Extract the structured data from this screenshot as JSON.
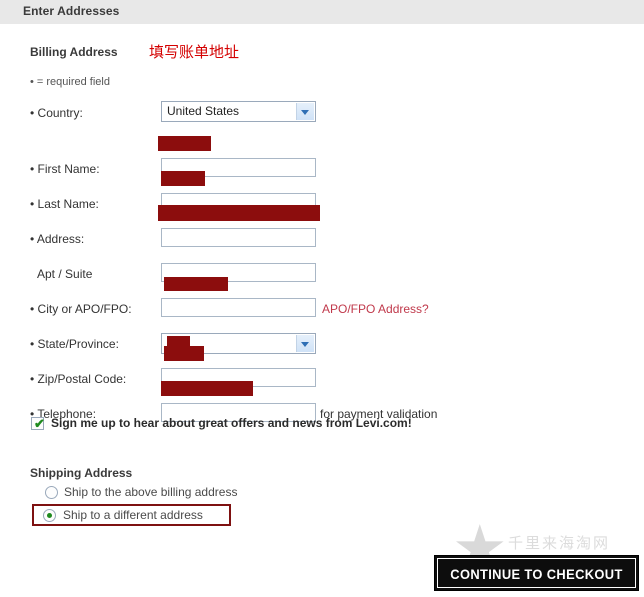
{
  "header": {
    "title": "Enter Addresses"
  },
  "billing": {
    "section_title": "Billing Address",
    "annotation_cn": "填写账单地址",
    "required_note": "• = required field",
    "fields": [
      {
        "label": "• Country:",
        "type": "select",
        "value": "United States",
        "name": "country"
      },
      {
        "label": "• First Name:",
        "type": "text",
        "value": "",
        "redacted": true,
        "name": "first-name"
      },
      {
        "label": "• Last Name:",
        "type": "text",
        "value": "",
        "redacted": true,
        "name": "last-name"
      },
      {
        "label": "• Address:",
        "type": "text",
        "value": "",
        "redacted": true,
        "name": "address"
      },
      {
        "label": "Apt / Suite",
        "type": "text",
        "value": "",
        "redacted": false,
        "name": "apt-suite"
      },
      {
        "label": "• City or APO/FPO:",
        "type": "text",
        "value": "",
        "redacted": true,
        "name": "city",
        "side_link": "APO/FPO Address?"
      },
      {
        "label": "• State/Province:",
        "type": "select",
        "value": "",
        "redacted": true,
        "name": "state"
      },
      {
        "label": "• Zip/Postal Code:",
        "type": "text",
        "value": "",
        "redacted": true,
        "name": "zip"
      },
      {
        "label": "• Telephone:",
        "type": "text",
        "value": "",
        "redacted": true,
        "name": "telephone",
        "side_hint": "for payment validation"
      }
    ]
  },
  "optin": {
    "label": "Sign me up to hear about great offers and news from Levi.com!",
    "checked": true,
    "checkmark": "✔"
  },
  "shipping": {
    "section_title": "Shipping Address",
    "options": [
      {
        "label": "Ship to the above billing address",
        "selected": false
      },
      {
        "label": "Ship to a different address",
        "selected": true
      }
    ]
  },
  "watermark": {
    "star": "★",
    "text": "千里来海淘网"
  },
  "actions": {
    "continue_label": "CONTINUE TO CHECKOUT"
  },
  "colors": {
    "redaction": "#8c0d0d",
    "annotation": "#d40000",
    "link": "#c0394b",
    "highlight_border": "#7e1111",
    "check_green": "#1f8a1f",
    "header_bg": "#e8e8e8"
  }
}
